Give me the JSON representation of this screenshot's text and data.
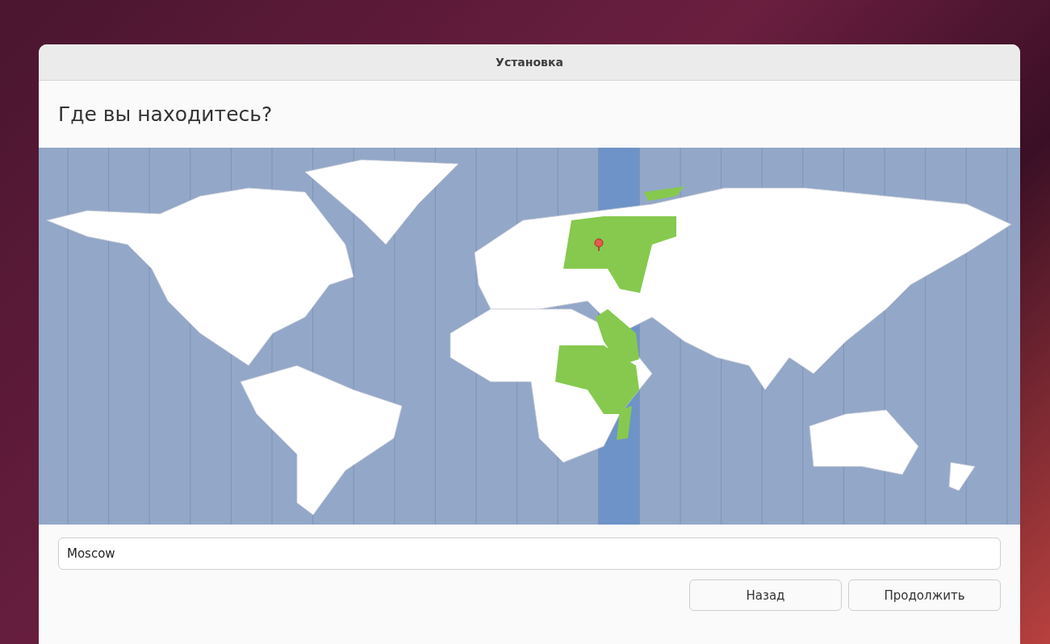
{
  "window": {
    "title": "Установка"
  },
  "heading": "Где вы находитесь?",
  "location_field": {
    "value": "Moscow"
  },
  "buttons": [
    {
      "label": "Назад"
    },
    {
      "label": "Продолжить"
    }
  ]
}
